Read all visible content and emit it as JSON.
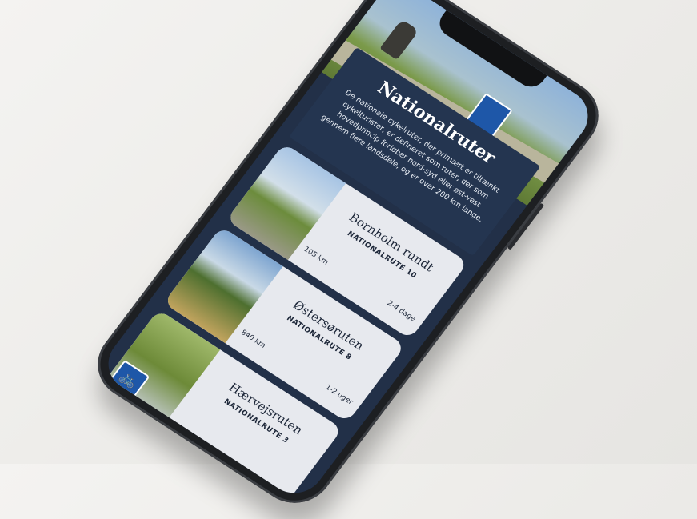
{
  "app": {
    "title": "Nationalruter",
    "description": "De nationale cykelruter, der primært er tiltænkt cykelturister, er defineret som ruter, der som hovedprincip forløber nord-syd eller øst-vest gennem flere landsdele, og er over 200 km lange."
  },
  "routes": [
    {
      "name": "Bornholm rundt",
      "route": "NATIONALRUTE 10",
      "distance": "105 km",
      "duration": "2-4 dage"
    },
    {
      "name": "Østersøruten",
      "route": "NATIONALRUTE 8",
      "distance": "840 km",
      "duration": "1-2 uger"
    },
    {
      "name": "Hærvejsruten",
      "route": "NATIONALRUTE 3",
      "distance": "",
      "duration": ""
    }
  ],
  "icons": {
    "badge": "bicycle-icon"
  },
  "colors": {
    "panel": "#243550",
    "sign": "#1e57a8",
    "card": "#e7e9ee"
  }
}
